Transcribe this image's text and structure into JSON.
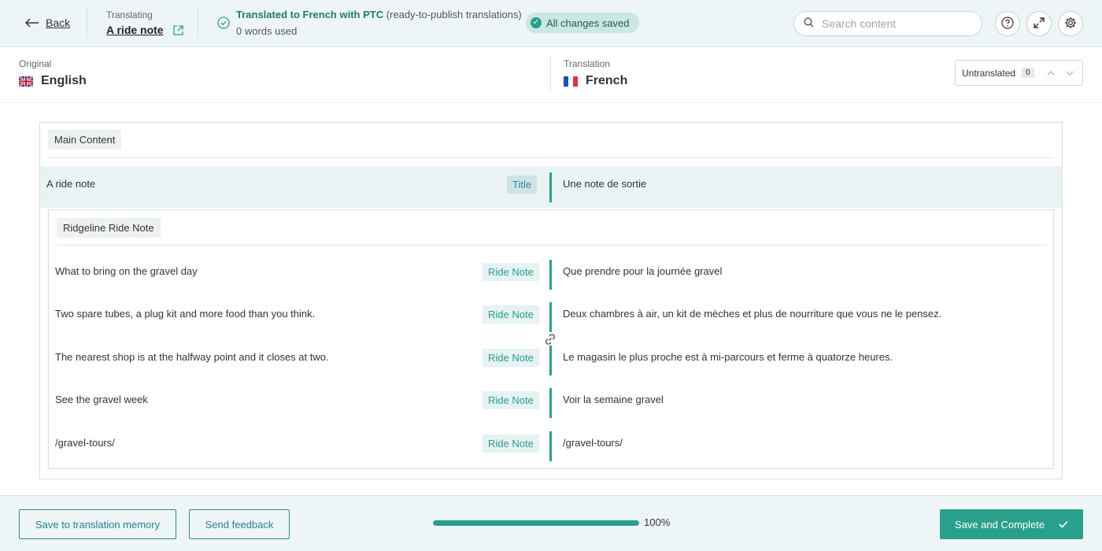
{
  "topbar": {
    "back_label": "Back",
    "translating_label": "Translating",
    "document_name": "A ride note",
    "status_title": "Translated to French with PTC",
    "status_note": "(ready-to-publish translations)",
    "words_used": "0 words used",
    "saved_badge": "All changes saved",
    "search_placeholder": "Search content"
  },
  "languages": {
    "original_label": "Original",
    "original_name": "English",
    "translation_label": "Translation",
    "translation_name": "French",
    "filter_label": "Untranslated",
    "filter_count": "0"
  },
  "content": {
    "section_tag": "Main Content",
    "title_row": {
      "original": "A ride note",
      "badge": "Title",
      "translation": "Une note de sortie"
    },
    "group_tag": "Ridgeline Ride Note",
    "rows": [
      {
        "original": "What to bring on the gravel day",
        "badge": "Ride Note",
        "translation": "Que prendre pour la journée gravel"
      },
      {
        "original": "Two spare tubes, a plug kit and more food than you think.",
        "badge": "Ride Note",
        "translation": "Deux chambres à air, un kit de mèches et plus de nourriture que vous ne le pensez."
      },
      {
        "original": "The nearest shop is at the halfway point and it closes at two.",
        "badge": "Ride Note",
        "translation": "Le magasin le plus proche est à mi-parcours et ferme à quatorze heures."
      },
      {
        "original": "See the gravel week",
        "badge": "Ride Note",
        "translation": "Voir la semaine gravel"
      },
      {
        "original": "/gravel-tours/",
        "badge": "Ride Note",
        "translation": "/gravel-tours/"
      }
    ]
  },
  "footer": {
    "save_memory_label": "Save to translation memory",
    "feedback_label": "Send feedback",
    "progress_text": "100%",
    "progress_value": 1.0,
    "complete_label": "Save and Complete"
  },
  "colors": {
    "accent": "#2aa08c",
    "topbar_bg": "#eef5f6",
    "row_highlight": "#e9f3f4"
  }
}
